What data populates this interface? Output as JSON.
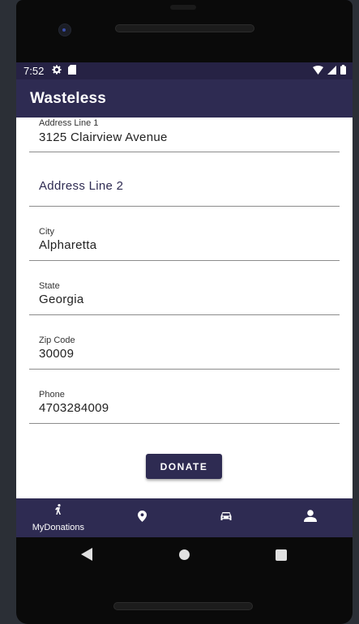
{
  "status_bar": {
    "time": "7:52"
  },
  "app_bar": {
    "title": "Wasteless"
  },
  "form": {
    "address_line1": {
      "label": "Address Line 1",
      "value": "3125 Clairview Avenue"
    },
    "address_line2": {
      "placeholder": "Address Line 2"
    },
    "city": {
      "label": "City",
      "value": "Alpharetta"
    },
    "state": {
      "label": "State",
      "value": "Georgia"
    },
    "zip": {
      "label": "Zip Code",
      "value": "30009"
    },
    "phone": {
      "label": "Phone",
      "value": "4703284009"
    },
    "donate_label": "DONATE"
  },
  "bottom_nav": [
    {
      "label": "MyDonations",
      "icon": "person-walking-icon",
      "active": true
    },
    {
      "label": "",
      "icon": "location-pin-icon"
    },
    {
      "label": "",
      "icon": "car-icon"
    },
    {
      "label": "",
      "icon": "account-icon"
    }
  ],
  "colors": {
    "primary": "#2e2b52",
    "status_bar": "#262244",
    "background": "#ffffff"
  }
}
